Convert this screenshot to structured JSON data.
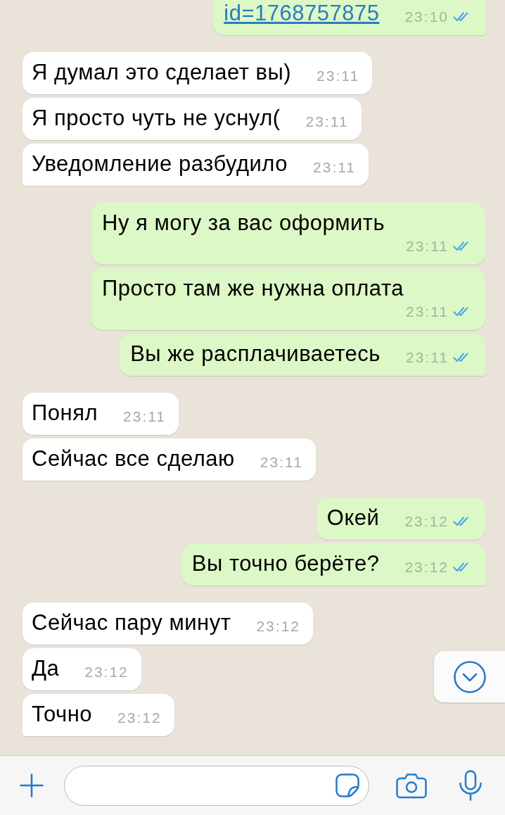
{
  "chat": {
    "groups": [
      {
        "outgoing": true,
        "messages": [
          {
            "kind": "link",
            "text": "id=1768757875",
            "time": "23:10",
            "read": true
          }
        ]
      },
      {
        "outgoing": false,
        "messages": [
          {
            "kind": "text",
            "text": "Я думал это сделает вы)",
            "time": "23:11"
          },
          {
            "kind": "text",
            "text": "Я просто чуть не уснул(",
            "time": "23:11"
          },
          {
            "kind": "text",
            "text": "Уведомление разбудило",
            "time": "23:11"
          }
        ]
      },
      {
        "outgoing": true,
        "messages": [
          {
            "kind": "text",
            "text": "Ну я могу за вас оформить",
            "time": "23:11",
            "read": true
          },
          {
            "kind": "text",
            "text": "Просто там же нужна оплата",
            "time": "23:11",
            "read": true
          },
          {
            "kind": "text",
            "text": "Вы же расплачиваетесь",
            "time": "23:11",
            "read": true
          }
        ]
      },
      {
        "outgoing": false,
        "messages": [
          {
            "kind": "text",
            "text": "Понял",
            "time": "23:11"
          },
          {
            "kind": "text",
            "text": "Сейчас все сделаю",
            "time": "23:11"
          }
        ]
      },
      {
        "outgoing": true,
        "messages": [
          {
            "kind": "text",
            "text": "Окей",
            "time": "23:12",
            "read": true
          },
          {
            "kind": "text",
            "text": "Вы точно берёте?",
            "time": "23:12",
            "read": true
          }
        ]
      },
      {
        "outgoing": false,
        "messages": [
          {
            "kind": "text",
            "text": "Сейчас пару минут",
            "time": "23:12"
          },
          {
            "kind": "text",
            "text": "Да",
            "time": "23:12"
          },
          {
            "kind": "text",
            "text": "Точно",
            "time": "23:12"
          }
        ]
      }
    ]
  }
}
